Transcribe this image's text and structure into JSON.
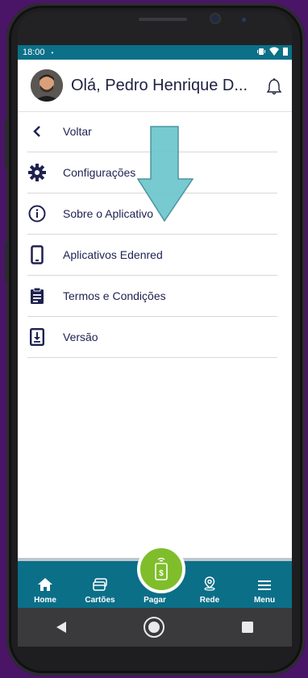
{
  "status": {
    "time": "18:00",
    "dot": "•"
  },
  "header": {
    "greeting": "Olá, Pedro Henrique D..."
  },
  "menu": {
    "items": [
      {
        "label": "Voltar",
        "icon": "chevron-left-icon"
      },
      {
        "label": "Configurações",
        "icon": "gear-icon"
      },
      {
        "label": "Sobre o Aplicativo",
        "icon": "info-icon"
      },
      {
        "label": "Aplicativos Edenred",
        "icon": "phone-icon"
      },
      {
        "label": "Termos e Condições",
        "icon": "clipboard-icon"
      },
      {
        "label": "Versão",
        "icon": "download-box-icon"
      }
    ]
  },
  "bottom_nav": {
    "items": [
      {
        "label": "Home",
        "icon": "home-icon"
      },
      {
        "label": "Cartões",
        "icon": "cards-icon"
      },
      {
        "label": "Pagar",
        "icon": "pay-icon"
      },
      {
        "label": "Rede",
        "icon": "location-pin-icon"
      },
      {
        "label": "Menu",
        "icon": "hamburger-icon"
      }
    ]
  },
  "colors": {
    "brand_teal": "#0b6f88",
    "pay_green": "#7fbe2a",
    "text_navy": "#1e2150",
    "overlay_arrow": "#6cc6cc",
    "background": "#4a1566"
  }
}
